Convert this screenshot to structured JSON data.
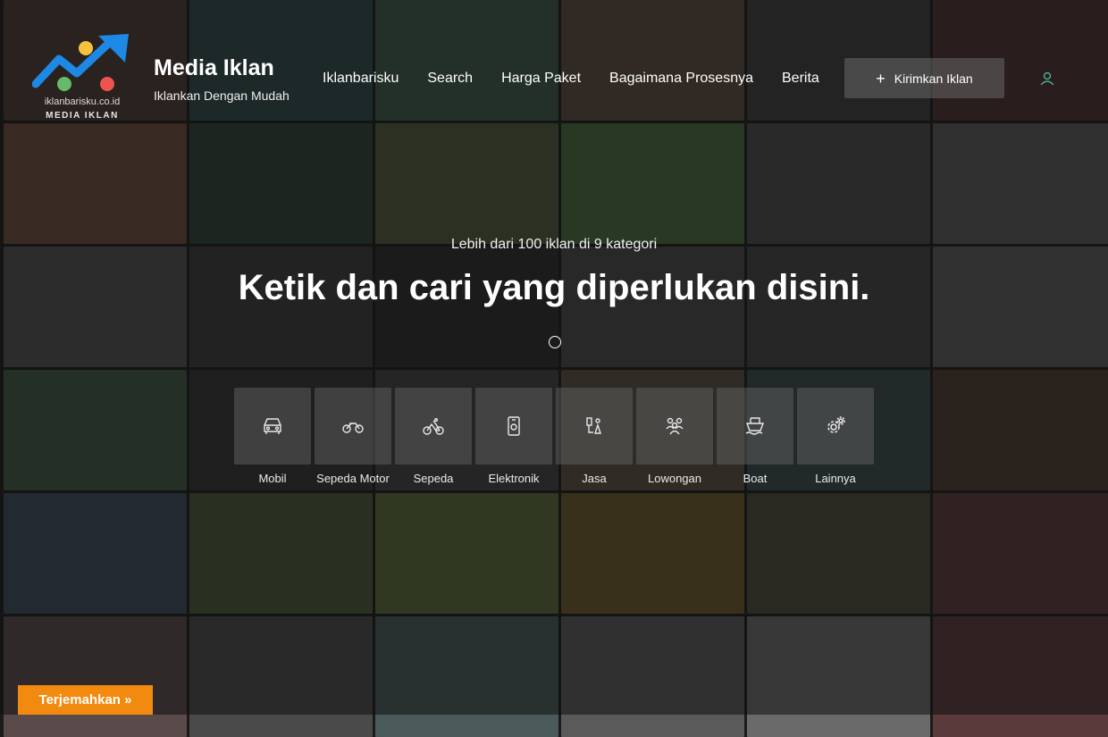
{
  "brand": {
    "logo_domain": "iklanbarisku.co.id",
    "logo_sub": "MEDIA IKLAN",
    "title": "Media Iklan",
    "tagline": "Iklankan Dengan Mudah",
    "colors": {
      "arrow": "#1e88e5",
      "dot_yellow": "#f6c23e",
      "dot_red": "#ef5350",
      "dot_green": "#66bb6a"
    }
  },
  "nav": {
    "items": [
      "Iklanbarisku",
      "Search",
      "Harga Paket",
      "Bagaimana Prosesnya",
      "Berita"
    ]
  },
  "header": {
    "post_button": "Kirimkan Iklan",
    "user_icon": "user-icon"
  },
  "hero": {
    "subtitle": "Lebih dari 100 iklan di 9 kategori",
    "title": "Ketik dan cari yang diperlukan disini."
  },
  "categories": [
    {
      "label": "Mobil",
      "icon": "car-icon"
    },
    {
      "label": "Sepeda Motor",
      "icon": "motorcycle-icon"
    },
    {
      "label": "Sepeda",
      "icon": "bicycle-icon"
    },
    {
      "label": "Elektronik",
      "icon": "phone-icon"
    },
    {
      "label": "Jasa",
      "icon": "service-icon"
    },
    {
      "label": "Lowongan",
      "icon": "people-icon"
    },
    {
      "label": "Boat",
      "icon": "boat-icon"
    },
    {
      "label": "Lainnya",
      "icon": "gears-icon"
    }
  ],
  "translate": {
    "label": "Terjemahkan »",
    "color": "#f28a10"
  }
}
